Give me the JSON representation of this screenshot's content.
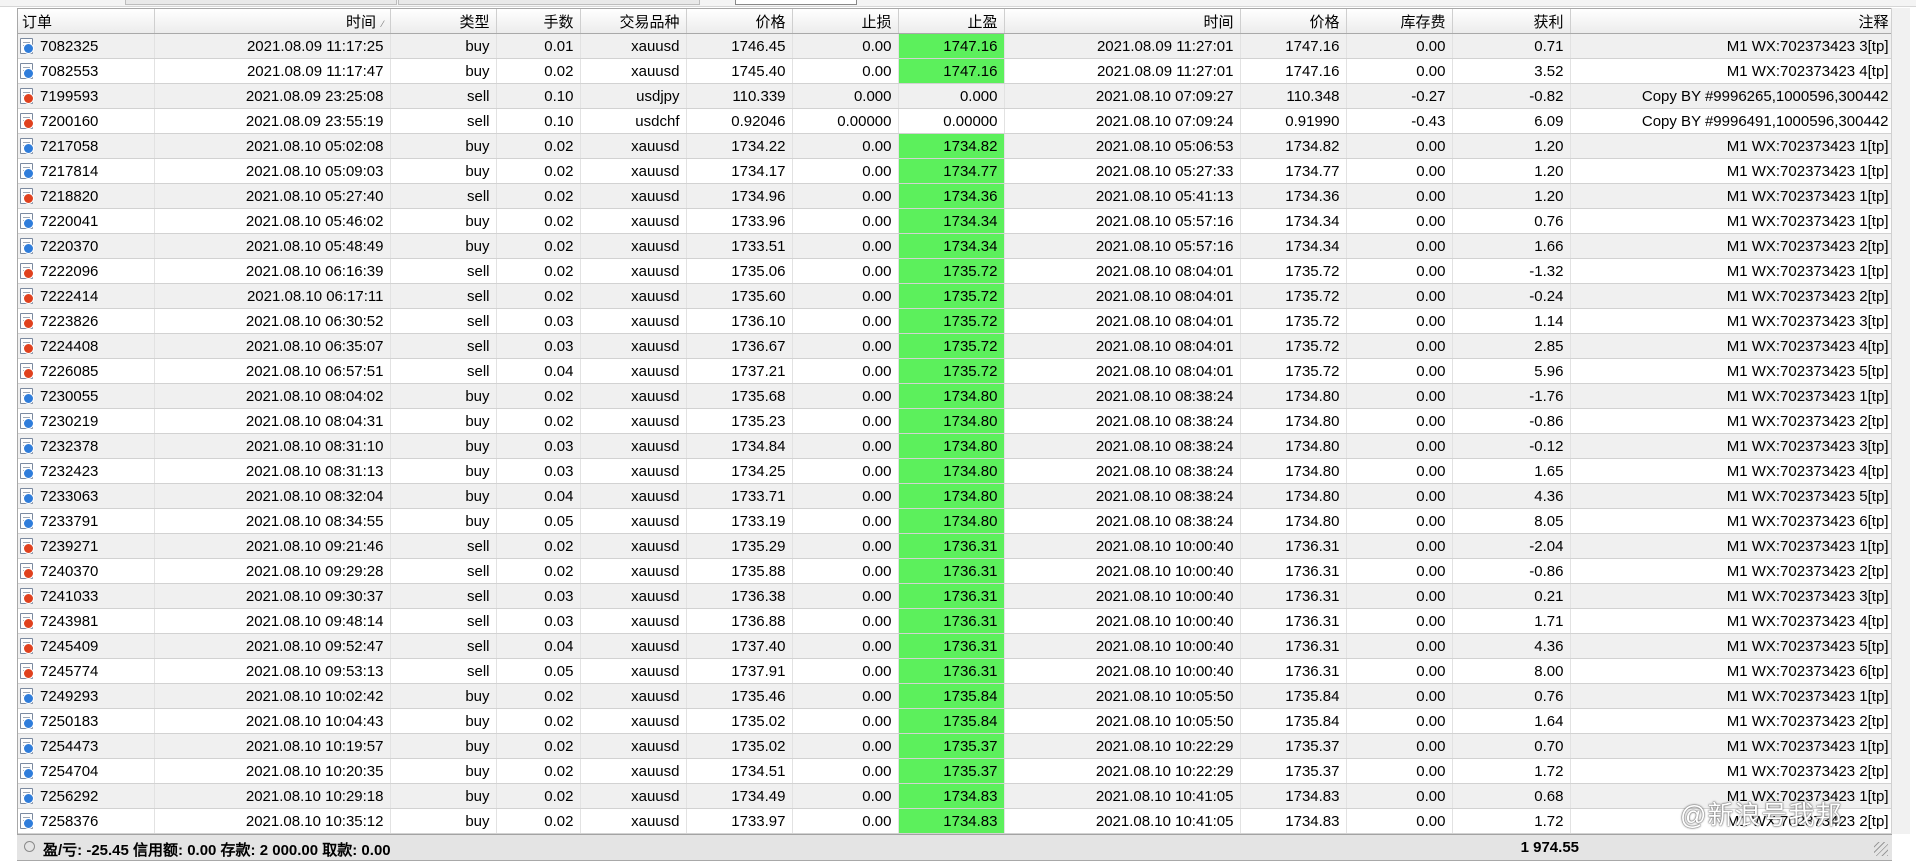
{
  "columns": [
    "订单",
    "时间",
    "类型",
    "手数",
    "交易品种",
    "价格",
    "止损",
    "止盈",
    "时间",
    "价格",
    "库存费",
    "获利",
    "注释"
  ],
  "sort_icon": "sort-indicator-icon",
  "colors": {
    "tp_highlight": "#5cf05c",
    "buy_icon": "#2f7ddb",
    "sell_icon": "#e0411e",
    "row_alt": "#f0f0f0"
  },
  "rows": [
    [
      "7082325",
      "2021.08.09 11:17:25",
      "buy",
      "0.01",
      "xauusd",
      "1746.45",
      "0.00",
      "1747.16",
      "2021.08.09 11:27:01",
      "1747.16",
      "0.00",
      "0.71",
      "M1 WX:702373423 3[tp]"
    ],
    [
      "7082553",
      "2021.08.09 11:17:47",
      "buy",
      "0.02",
      "xauusd",
      "1745.40",
      "0.00",
      "1747.16",
      "2021.08.09 11:27:01",
      "1747.16",
      "0.00",
      "3.52",
      "M1 WX:702373423 4[tp]"
    ],
    [
      "7199593",
      "2021.08.09 23:25:08",
      "sell",
      "0.10",
      "usdjpy",
      "110.339",
      "0.000",
      "0.000",
      "2021.08.10 07:09:27",
      "110.348",
      "-0.27",
      "-0.82",
      "Copy BY #9996265,1000596,300442"
    ],
    [
      "7200160",
      "2021.08.09 23:55:19",
      "sell",
      "0.10",
      "usdchf",
      "0.92046",
      "0.00000",
      "0.00000",
      "2021.08.10 07:09:24",
      "0.91990",
      "-0.43",
      "6.09",
      "Copy BY #9996491,1000596,300442"
    ],
    [
      "7217058",
      "2021.08.10 05:02:08",
      "buy",
      "0.02",
      "xauusd",
      "1734.22",
      "0.00",
      "1734.82",
      "2021.08.10 05:06:53",
      "1734.82",
      "0.00",
      "1.20",
      "M1 WX:702373423 1[tp]"
    ],
    [
      "7217814",
      "2021.08.10 05:09:03",
      "buy",
      "0.02",
      "xauusd",
      "1734.17",
      "0.00",
      "1734.77",
      "2021.08.10 05:27:33",
      "1734.77",
      "0.00",
      "1.20",
      "M1 WX:702373423 1[tp]"
    ],
    [
      "7218820",
      "2021.08.10 05:27:40",
      "sell",
      "0.02",
      "xauusd",
      "1734.96",
      "0.00",
      "1734.36",
      "2021.08.10 05:41:13",
      "1734.36",
      "0.00",
      "1.20",
      "M1 WX:702373423 1[tp]"
    ],
    [
      "7220041",
      "2021.08.10 05:46:02",
      "buy",
      "0.02",
      "xauusd",
      "1733.96",
      "0.00",
      "1734.34",
      "2021.08.10 05:57:16",
      "1734.34",
      "0.00",
      "0.76",
      "M1 WX:702373423 1[tp]"
    ],
    [
      "7220370",
      "2021.08.10 05:48:49",
      "buy",
      "0.02",
      "xauusd",
      "1733.51",
      "0.00",
      "1734.34",
      "2021.08.10 05:57:16",
      "1734.34",
      "0.00",
      "1.66",
      "M1 WX:702373423 2[tp]"
    ],
    [
      "7222096",
      "2021.08.10 06:16:39",
      "sell",
      "0.02",
      "xauusd",
      "1735.06",
      "0.00",
      "1735.72",
      "2021.08.10 08:04:01",
      "1735.72",
      "0.00",
      "-1.32",
      "M1 WX:702373423 1[tp]"
    ],
    [
      "7222414",
      "2021.08.10 06:17:11",
      "sell",
      "0.02",
      "xauusd",
      "1735.60",
      "0.00",
      "1735.72",
      "2021.08.10 08:04:01",
      "1735.72",
      "0.00",
      "-0.24",
      "M1 WX:702373423 2[tp]"
    ],
    [
      "7223826",
      "2021.08.10 06:30:52",
      "sell",
      "0.03",
      "xauusd",
      "1736.10",
      "0.00",
      "1735.72",
      "2021.08.10 08:04:01",
      "1735.72",
      "0.00",
      "1.14",
      "M1 WX:702373423 3[tp]"
    ],
    [
      "7224408",
      "2021.08.10 06:35:07",
      "sell",
      "0.03",
      "xauusd",
      "1736.67",
      "0.00",
      "1735.72",
      "2021.08.10 08:04:01",
      "1735.72",
      "0.00",
      "2.85",
      "M1 WX:702373423 4[tp]"
    ],
    [
      "7226085",
      "2021.08.10 06:57:51",
      "sell",
      "0.04",
      "xauusd",
      "1737.21",
      "0.00",
      "1735.72",
      "2021.08.10 08:04:01",
      "1735.72",
      "0.00",
      "5.96",
      "M1 WX:702373423 5[tp]"
    ],
    [
      "7230055",
      "2021.08.10 08:04:02",
      "buy",
      "0.02",
      "xauusd",
      "1735.68",
      "0.00",
      "1734.80",
      "2021.08.10 08:38:24",
      "1734.80",
      "0.00",
      "-1.76",
      "M1 WX:702373423 1[tp]"
    ],
    [
      "7230219",
      "2021.08.10 08:04:31",
      "buy",
      "0.02",
      "xauusd",
      "1735.23",
      "0.00",
      "1734.80",
      "2021.08.10 08:38:24",
      "1734.80",
      "0.00",
      "-0.86",
      "M1 WX:702373423 2[tp]"
    ],
    [
      "7232378",
      "2021.08.10 08:31:10",
      "buy",
      "0.03",
      "xauusd",
      "1734.84",
      "0.00",
      "1734.80",
      "2021.08.10 08:38:24",
      "1734.80",
      "0.00",
      "-0.12",
      "M1 WX:702373423 3[tp]"
    ],
    [
      "7232423",
      "2021.08.10 08:31:13",
      "buy",
      "0.03",
      "xauusd",
      "1734.25",
      "0.00",
      "1734.80",
      "2021.08.10 08:38:24",
      "1734.80",
      "0.00",
      "1.65",
      "M1 WX:702373423 4[tp]"
    ],
    [
      "7233063",
      "2021.08.10 08:32:04",
      "buy",
      "0.04",
      "xauusd",
      "1733.71",
      "0.00",
      "1734.80",
      "2021.08.10 08:38:24",
      "1734.80",
      "0.00",
      "4.36",
      "M1 WX:702373423 5[tp]"
    ],
    [
      "7233791",
      "2021.08.10 08:34:55",
      "buy",
      "0.05",
      "xauusd",
      "1733.19",
      "0.00",
      "1734.80",
      "2021.08.10 08:38:24",
      "1734.80",
      "0.00",
      "8.05",
      "M1 WX:702373423 6[tp]"
    ],
    [
      "7239271",
      "2021.08.10 09:21:46",
      "sell",
      "0.02",
      "xauusd",
      "1735.29",
      "0.00",
      "1736.31",
      "2021.08.10 10:00:40",
      "1736.31",
      "0.00",
      "-2.04",
      "M1 WX:702373423 1[tp]"
    ],
    [
      "7240370",
      "2021.08.10 09:29:28",
      "sell",
      "0.02",
      "xauusd",
      "1735.88",
      "0.00",
      "1736.31",
      "2021.08.10 10:00:40",
      "1736.31",
      "0.00",
      "-0.86",
      "M1 WX:702373423 2[tp]"
    ],
    [
      "7241033",
      "2021.08.10 09:30:37",
      "sell",
      "0.03",
      "xauusd",
      "1736.38",
      "0.00",
      "1736.31",
      "2021.08.10 10:00:40",
      "1736.31",
      "0.00",
      "0.21",
      "M1 WX:702373423 3[tp]"
    ],
    [
      "7243981",
      "2021.08.10 09:48:14",
      "sell",
      "0.03",
      "xauusd",
      "1736.88",
      "0.00",
      "1736.31",
      "2021.08.10 10:00:40",
      "1736.31",
      "0.00",
      "1.71",
      "M1 WX:702373423 4[tp]"
    ],
    [
      "7245409",
      "2021.08.10 09:52:47",
      "sell",
      "0.04",
      "xauusd",
      "1737.40",
      "0.00",
      "1736.31",
      "2021.08.10 10:00:40",
      "1736.31",
      "0.00",
      "4.36",
      "M1 WX:702373423 5[tp]"
    ],
    [
      "7245774",
      "2021.08.10 09:53:13",
      "sell",
      "0.05",
      "xauusd",
      "1737.91",
      "0.00",
      "1736.31",
      "2021.08.10 10:00:40",
      "1736.31",
      "0.00",
      "8.00",
      "M1 WX:702373423 6[tp]"
    ],
    [
      "7249293",
      "2021.08.10 10:02:42",
      "buy",
      "0.02",
      "xauusd",
      "1735.46",
      "0.00",
      "1735.84",
      "2021.08.10 10:05:50",
      "1735.84",
      "0.00",
      "0.76",
      "M1 WX:702373423 1[tp]"
    ],
    [
      "7250183",
      "2021.08.10 10:04:43",
      "buy",
      "0.02",
      "xauusd",
      "1735.02",
      "0.00",
      "1735.84",
      "2021.08.10 10:05:50",
      "1735.84",
      "0.00",
      "1.64",
      "M1 WX:702373423 2[tp]"
    ],
    [
      "7254473",
      "2021.08.10 10:19:57",
      "buy",
      "0.02",
      "xauusd",
      "1735.02",
      "0.00",
      "1735.37",
      "2021.08.10 10:22:29",
      "1735.37",
      "0.00",
      "0.70",
      "M1 WX:702373423 1[tp]"
    ],
    [
      "7254704",
      "2021.08.10 10:20:35",
      "buy",
      "0.02",
      "xauusd",
      "1734.51",
      "0.00",
      "1735.37",
      "2021.08.10 10:22:29",
      "1735.37",
      "0.00",
      "1.72",
      "M1 WX:702373423 2[tp]"
    ],
    [
      "7256292",
      "2021.08.10 10:29:18",
      "buy",
      "0.02",
      "xauusd",
      "1734.49",
      "0.00",
      "1734.83",
      "2021.08.10 10:41:05",
      "1734.83",
      "0.00",
      "0.68",
      "M1 WX:702373423 1[tp]"
    ],
    [
      "7258376",
      "2021.08.10 10:35:12",
      "buy",
      "0.02",
      "xauusd",
      "1733.97",
      "0.00",
      "1734.83",
      "2021.08.10 10:41:05",
      "1734.83",
      "0.00",
      "1.72",
      "M1 WX:702373423 2[tp]"
    ]
  ],
  "status": {
    "summary": "盈/亏: -25.45  信用额: 0.00  存款: 2 000.00  取款: 0.00",
    "total": "1 974.55"
  },
  "watermark": "@新浪号我邦"
}
